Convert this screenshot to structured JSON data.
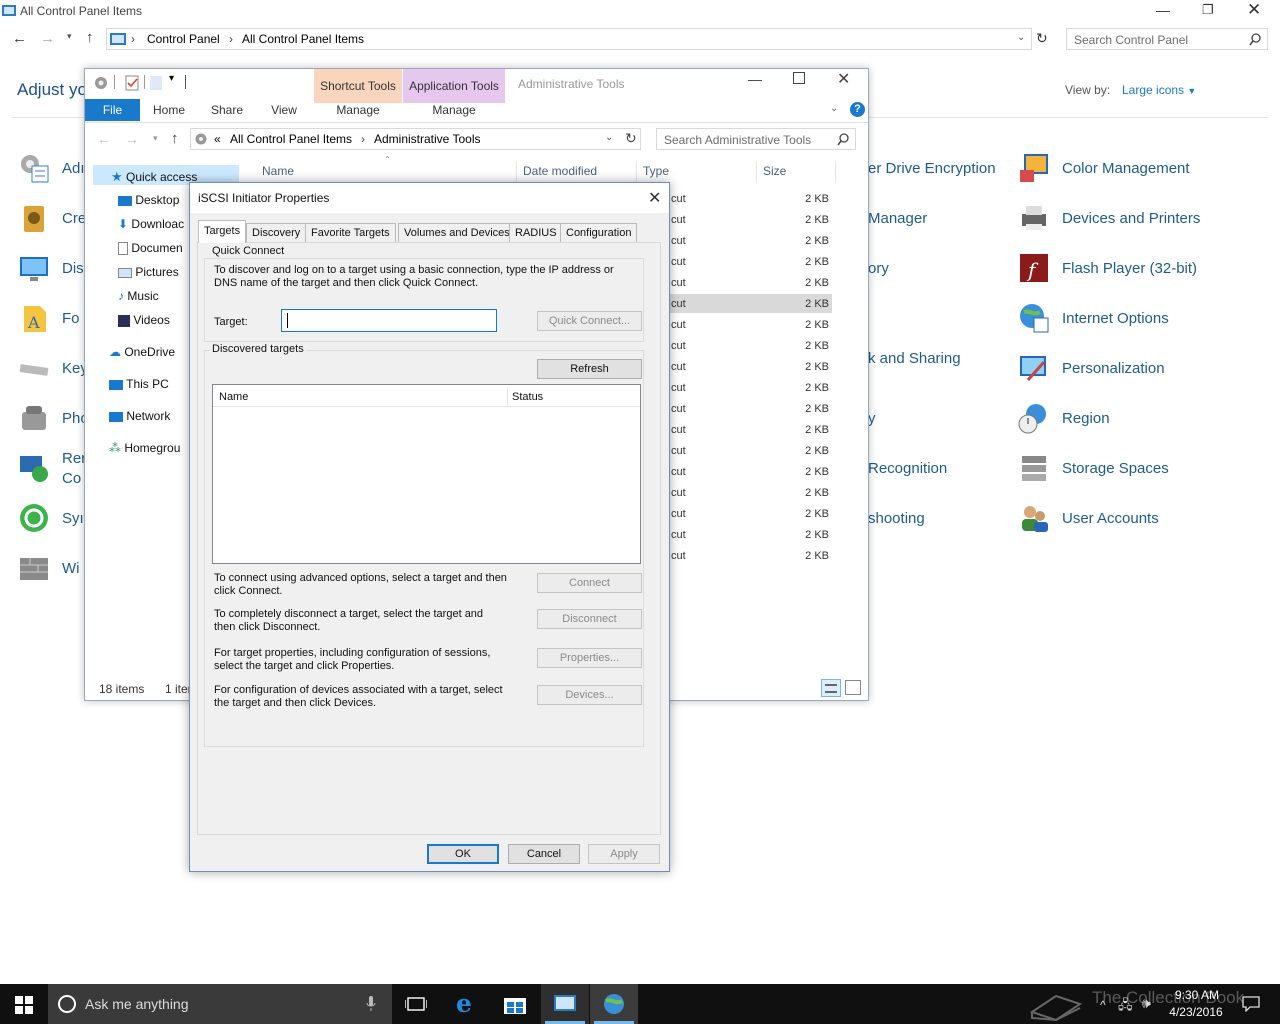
{
  "control_panel": {
    "window_title": "All Control Panel Items",
    "breadcrumb": [
      "Control Panel",
      "All Control Panel Items"
    ],
    "search_placeholder": "Search Control Panel",
    "heading_partial": "Adjust yo",
    "view_by_label": "View by:",
    "view_by_value": "Large icons",
    "left_partial_items": [
      "Adı",
      "Cre",
      "Dis",
      "Fo",
      "Key",
      "Pho",
      "Rer",
      "Co",
      "Syı",
      "Wi"
    ],
    "middle_partial_items": [
      "er Drive Encryption",
      "Manager",
      "ory",
      "k and Sharing",
      "y",
      "Recognition",
      "shooting"
    ],
    "right_items": [
      "Color Management",
      "Devices and Printers",
      "Flash Player (32-bit)",
      "Internet Options",
      "Personalization",
      "Region",
      "Storage Spaces",
      "User Accounts"
    ]
  },
  "explorer": {
    "title": "Administrative Tools",
    "contextual_tabs": [
      "Shortcut Tools",
      "Application Tools"
    ],
    "ribbon_tabs": [
      "File",
      "Home",
      "Share",
      "View",
      "Manage",
      "Manage"
    ],
    "address": [
      "All Control Panel Items",
      "Administrative Tools"
    ],
    "address_prefix": "«",
    "search_placeholder": "Search Administrative Tools",
    "columns": [
      "Name",
      "Date modified",
      "Type",
      "Size"
    ],
    "nav": [
      "Quick access",
      "Desktop",
      "Downloac",
      "Documen",
      "Pictures",
      "Music",
      "Videos",
      "OneDrive",
      "This PC",
      "Network",
      "Homegrou"
    ],
    "rows_type": "cut",
    "rows_size": "2 KB",
    "row_count": 18,
    "status_items": "18 items",
    "status_selected": "1 iter"
  },
  "dialog": {
    "title": "iSCSI Initiator Properties",
    "tabs": [
      "Targets",
      "Discovery",
      "Favorite Targets",
      "Volumes and Devices",
      "RADIUS",
      "Configuration"
    ],
    "quick_connect_group": "Quick Connect",
    "quick_connect_desc1": "To discover and log on to a target using a basic connection, type the IP address or",
    "quick_connect_desc2": "DNS name of the target and then click Quick Connect.",
    "target_label": "Target:",
    "target_value": "",
    "quick_connect_btn": "Quick Connect...",
    "discovered_group": "Discovered targets",
    "refresh_btn": "Refresh",
    "list_columns": [
      "Name",
      "Status"
    ],
    "connect_desc1": "To connect using advanced options, select a target and then",
    "connect_desc2": "click Connect.",
    "connect_btn": "Connect",
    "disconnect_desc1": "To completely disconnect a target, select the target and",
    "disconnect_desc2": "then click Disconnect.",
    "disconnect_btn": "Disconnect",
    "properties_desc1": "For target properties, including configuration of sessions,",
    "properties_desc2": "select the target and click Properties.",
    "properties_btn": "Properties...",
    "devices_desc1": "For configuration of devices associated with a target, select",
    "devices_desc2": "the target and then click Devices.",
    "devices_btn": "Devices...",
    "ok": "OK",
    "cancel": "Cancel",
    "apply": "Apply"
  },
  "taskbar": {
    "search_placeholder": "Ask me anything",
    "time": "9:30 AM",
    "date": "4/23/2016",
    "watermark": "The Collection Book"
  },
  "colors": {
    "link": "#1e5c8c",
    "accent": "#1979ca",
    "taskbar": "#101010"
  }
}
